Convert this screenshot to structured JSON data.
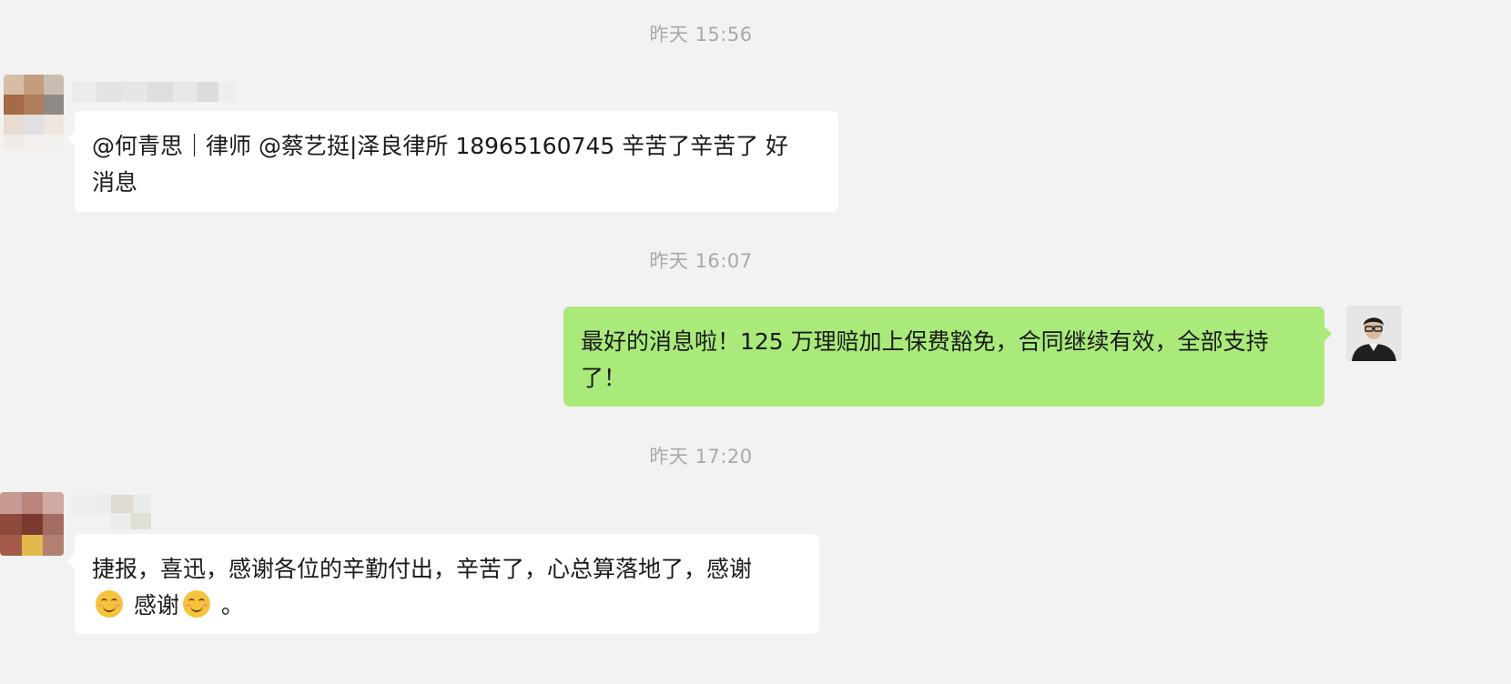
{
  "timestamps": [
    "昨天 15:56",
    "昨天 16:07",
    "昨天 17:20"
  ],
  "messages": [
    {
      "direction": "in",
      "lines": [
        "@何青思｜律师 @蔡艺挺|泽良律所 18965160745 辛苦了辛苦了 好",
        "消息"
      ]
    },
    {
      "direction": "out",
      "lines": [
        "最好的消息啦！125 万理赔加上保费豁免，合同继续有效，全部支持",
        "了！"
      ]
    },
    {
      "direction": "in",
      "line1": "捷报，喜迅，感谢各位的辛勤付出，辛苦了，心总算落地了，感谢",
      "line2_a": "感谢",
      "line2_b": "。",
      "emoji": "smiling-face-icon"
    }
  ],
  "colors": {
    "background": "#f2f2f2",
    "incoming_bubble": "#ffffff",
    "outgoing_bubble": "#a9ea7a",
    "timestamp": "#a9a9a9"
  }
}
